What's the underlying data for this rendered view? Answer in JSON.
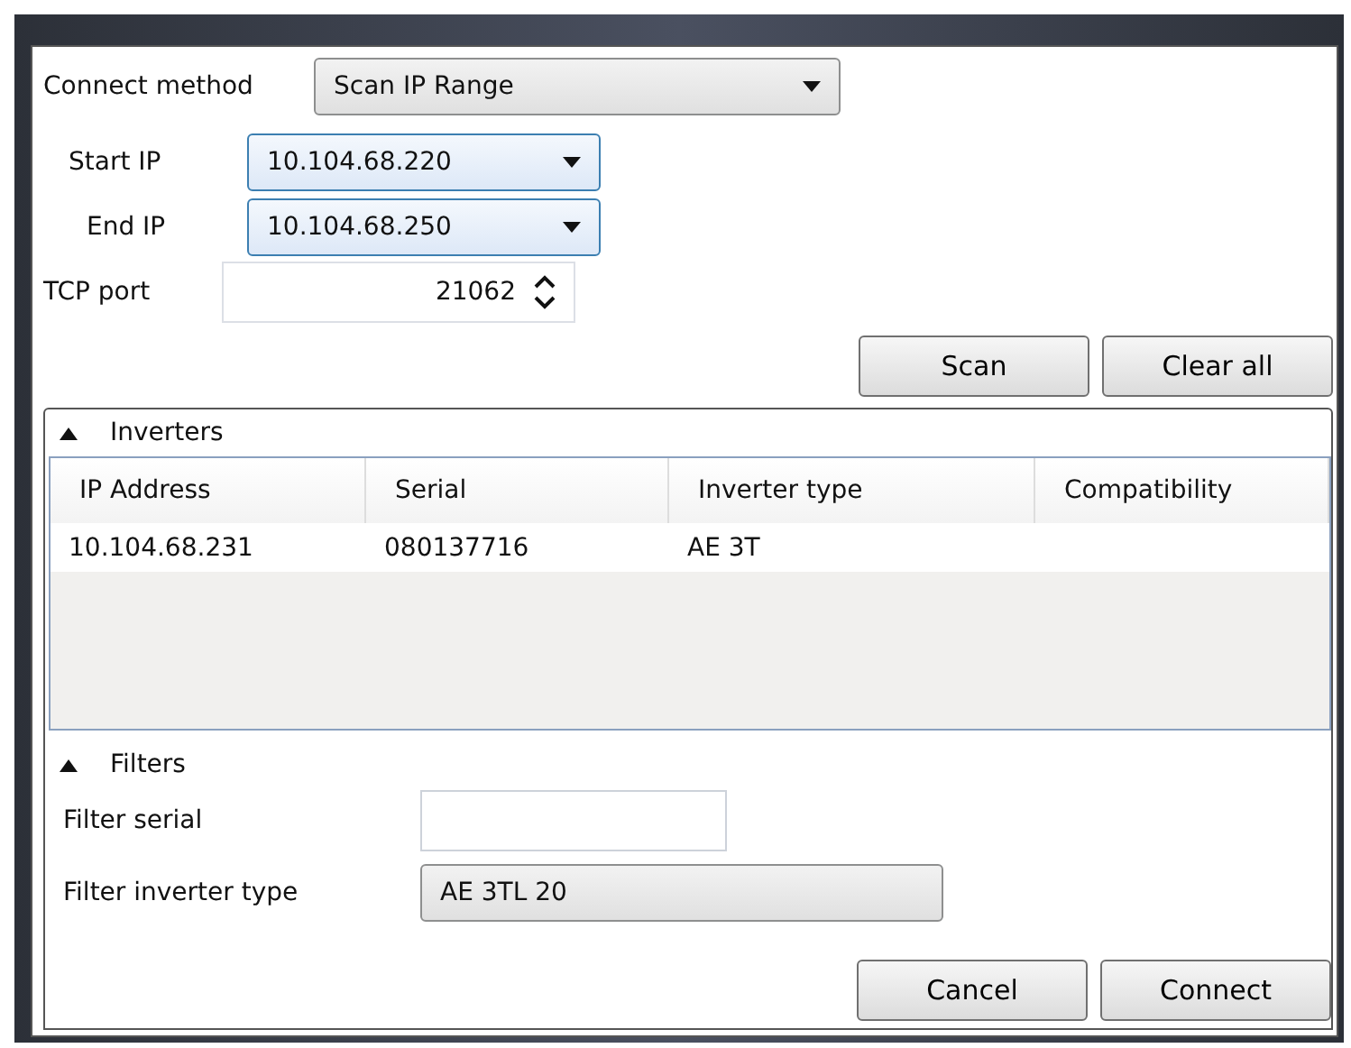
{
  "connect_method": {
    "label": "Connect method",
    "value": "Scan IP Range"
  },
  "start_ip": {
    "label": "Start IP",
    "value": "10.104.68.220"
  },
  "end_ip": {
    "label": "End IP",
    "value": "10.104.68.250"
  },
  "tcp_port": {
    "label": "TCP port",
    "value": "21062"
  },
  "scan_buttons": [
    "Scan",
    "Clear all"
  ],
  "inverters": {
    "title": "Inverters",
    "expanded": true,
    "columns": [
      "IP Address",
      "Serial",
      "Inverter type",
      "Compatibility"
    ],
    "rows": [
      [
        "10.104.68.231",
        "080137716",
        "AE 3T"
      ]
    ]
  },
  "filters": {
    "title": "Filters",
    "expanded": true,
    "serial": {
      "label": "Filter serial"
    },
    "type": {
      "label": "Filter inverter type",
      "value": "AE 3TL 20"
    }
  },
  "buttons": [
    "Cancel",
    "Connect"
  ]
}
